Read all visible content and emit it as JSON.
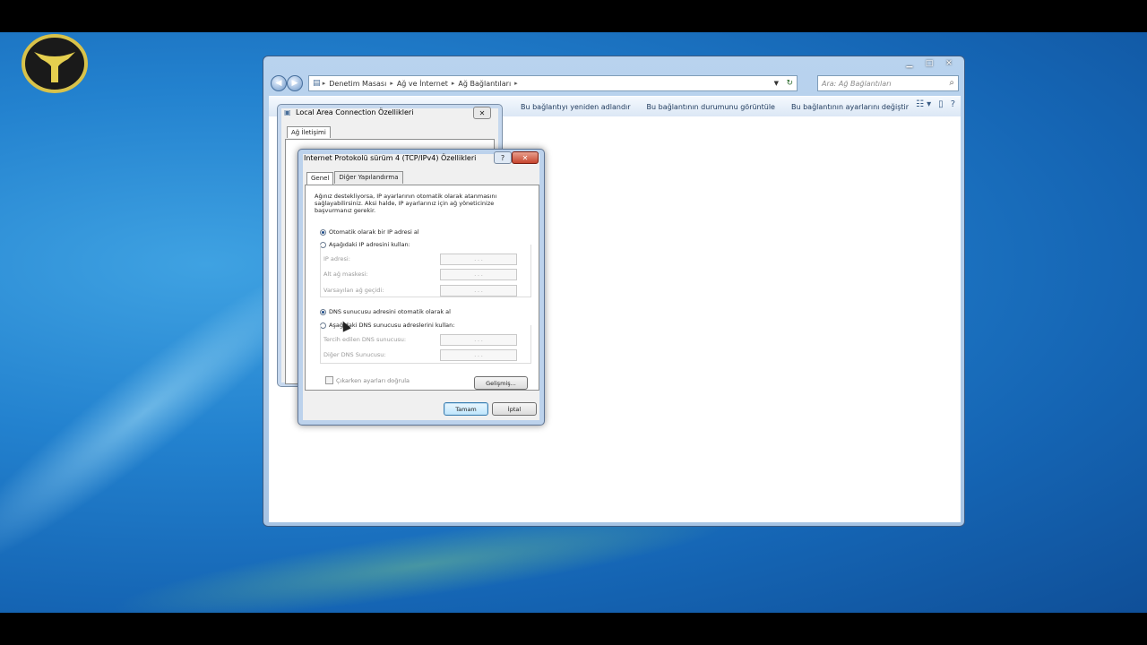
{
  "explorer": {
    "breadcrumbs": [
      "Denetim Masası",
      "Ağ ve İnternet",
      "Ağ Bağlantıları"
    ],
    "search_placeholder": "Ara: Ağ Bağlantıları",
    "toolbar": [
      "Bu bağlantıyı yeniden adlandır",
      "Bu bağlantının durumunu görüntüle",
      "Bu bağlantının ayarlarını değiştir"
    ]
  },
  "lac_dialog": {
    "title": "Local Area Connection Özellikleri",
    "tab": "Ağ İletişimi"
  },
  "ipv4_dialog": {
    "title": "Internet Protokolü sürüm 4 (TCP/IPv4) Özellikleri",
    "tabs": [
      "Genel",
      "Diğer Yapılandırma"
    ],
    "description": "Ağınız destekliyorsa, IP ayarlarının otomatik olarak atanmasını sağlayabilirsiniz. Aksi halde, IP ayarlarınız için ağ yöneticinize başvurmanız gerekir.",
    "ip_auto": "Otomatik olarak bir IP adresi al",
    "ip_manual": "Aşağıdaki IP adresini kullan:",
    "ip_address": "IP adresi:",
    "subnet_mask": "Alt ağ maskesi:",
    "default_gateway": "Varsayılan ağ geçidi:",
    "dns_auto": "DNS sunucusu adresini otomatik olarak al",
    "dns_manual": "Aşağıdaki DNS sunucusu adreslerini kullan:",
    "preferred_dns": "Tercih edilen DNS sunucusu:",
    "alternate_dns": "Diğer DNS Sunucusu:",
    "validate": "Çıkarken ayarları doğrula",
    "advanced": "Gelişmiş...",
    "ok": "Tamam",
    "cancel": "İptal",
    "ip_placeholder": ". . ."
  }
}
